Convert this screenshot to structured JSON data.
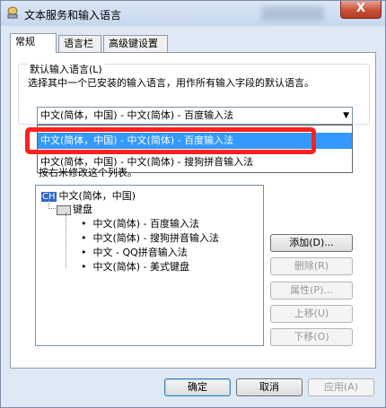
{
  "window": {
    "title": "文本服务和输入语言",
    "close": "X"
  },
  "tabs": [
    {
      "label": "常规",
      "active": true
    },
    {
      "label": "语言栏",
      "active": false
    },
    {
      "label": "高级键设置",
      "active": false
    }
  ],
  "default_language": {
    "group_label": "默认输入语言(L)",
    "description": "选择其中一个已安装的输入语言，用作所有输入字段的默认语言。",
    "selected": "中文(简体，中国) - 中文(简体) - 百度输入法",
    "options": [
      {
        "label": "中文(简体，中国) - 中文(简体) - 百度输入法",
        "highlighted": true
      },
      {
        "label": "中文(简体，中国) - 中文(简体) - 搜狗拼音输入法",
        "highlighted": false
      }
    ]
  },
  "installed": {
    "partial_label": "按右米修改这个列表。",
    "tree": {
      "language_code": "CH",
      "language": "中文(简体，中国)",
      "category": "键盘",
      "items": [
        "中文(简体) - 百度输入法",
        "中文(简体) - 搜狗拼音输入法",
        "中文 - QQ拼音输入法",
        "中文(简体) - 美式键盘"
      ]
    }
  },
  "side_buttons": {
    "add": "添加(D)...",
    "remove": "删除(R)",
    "properties": "属性(P)...",
    "move_up": "上移(U)",
    "move_down": "下移(O)"
  },
  "footer": {
    "ok": "确定",
    "cancel": "取消",
    "apply": "应用(A)"
  }
}
